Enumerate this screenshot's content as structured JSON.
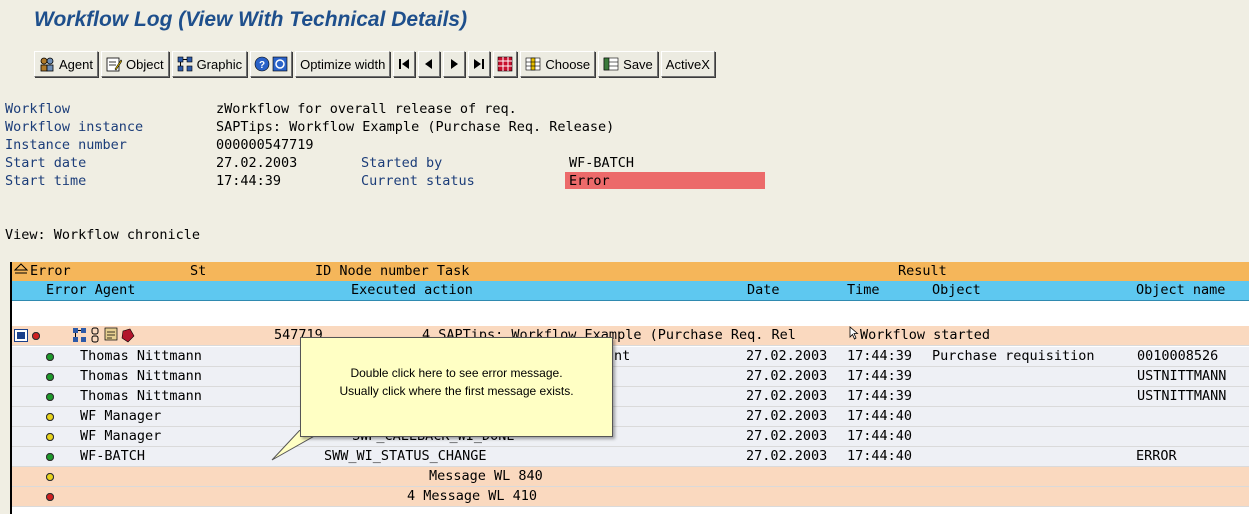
{
  "window": {
    "title": "Workflow Log (View With Technical Details)"
  },
  "toolbar": {
    "agent": "Agent",
    "object": "Object",
    "graphic": "Graphic",
    "optimize": "Optimize width",
    "choose": "Choose",
    "save": "Save",
    "activex": "ActiveX"
  },
  "header": {
    "workflow_label": "Workflow",
    "workflow_value": "zWorkflow for overall release of req.",
    "instance_label": "Workflow instance",
    "instance_value": "SAPTips: Workflow Example (Purchase Req. Release)",
    "number_label": "Instance number",
    "number_value": "000000547719",
    "start_date_label": "Start date",
    "start_date_value": "27.02.2003",
    "started_by_label": "Started by",
    "started_by_value": "WF-BATCH",
    "start_time_label": "Start time",
    "start_time_value": "17:44:39",
    "status_label": "Current status",
    "status_value": "Error",
    "status_color": "#ec6a6a"
  },
  "view_line": "View: Workflow chronicle",
  "grid": {
    "head1": {
      "error": "Error",
      "st": "St",
      "id_node_task": "ID Node number Task",
      "result": "Result"
    },
    "head2": {
      "error_agent": "Error Agent",
      "executed_action": "Executed action",
      "date": "Date",
      "time": "Time",
      "object": "Object",
      "object_name": "Object name"
    },
    "rows": [
      {
        "lights": [
          "red",
          "red",
          "red"
        ],
        "col1": "547719",
        "col2": "4 SAPTips: Workflow Example (Purchase Req. Rel",
        "col3": "Workflow started",
        "bg": "peach"
      },
      {
        "lights": [
          "green",
          "green",
          "green"
        ],
        "col1": "Thomas Nittmann",
        "col2": "nt",
        "date": "27.02.2003",
        "time": "17:44:39",
        "object": "Purchase requisition",
        "objname": "0010008526",
        "bg": "light"
      },
      {
        "lights": [
          "green",
          "green",
          "green"
        ],
        "col1": "Thomas Nittmann",
        "date": "27.02.2003",
        "time": "17:44:39",
        "objname": "USTNITTMANN",
        "bg": "light"
      },
      {
        "lights": [
          "green",
          "green",
          "green"
        ],
        "col1": "Thomas Nittmann",
        "date": "27.02.2003",
        "time": "17:44:39",
        "objname": "USTNITTMANN",
        "bg": "light"
      },
      {
        "lights": [
          "yellow",
          "yellow",
          "yellow"
        ],
        "col1": "WF Manager",
        "date": "27.02.2003",
        "time": "17:44:40",
        "bg": "light"
      },
      {
        "lights": [
          "red",
          "yellow",
          "yellow"
        ],
        "col1": "WF Manager",
        "col2": "SWP_CALLBACK_WI_DONE",
        "date": "27.02.2003",
        "time": "17:44:40",
        "bg": "light"
      },
      {
        "lights": [
          "green",
          "green",
          "green"
        ],
        "col1": "WF-BATCH",
        "col2": "SWW_WI_STATUS_CHANGE",
        "date": "27.02.2003",
        "time": "17:44:40",
        "objname": "ERROR",
        "bg": "light"
      },
      {
        "lights": [
          "yellow",
          "yellow",
          "yellow"
        ],
        "col2": "Message WL 840",
        "bg": "peach"
      },
      {
        "lights": [
          "red",
          "red",
          "red"
        ],
        "col2": "4  Message WL 410",
        "bg": "peach"
      }
    ]
  },
  "callout": {
    "line1": "Double click here to see error message.",
    "line2": "Usually click where the first message exists."
  }
}
